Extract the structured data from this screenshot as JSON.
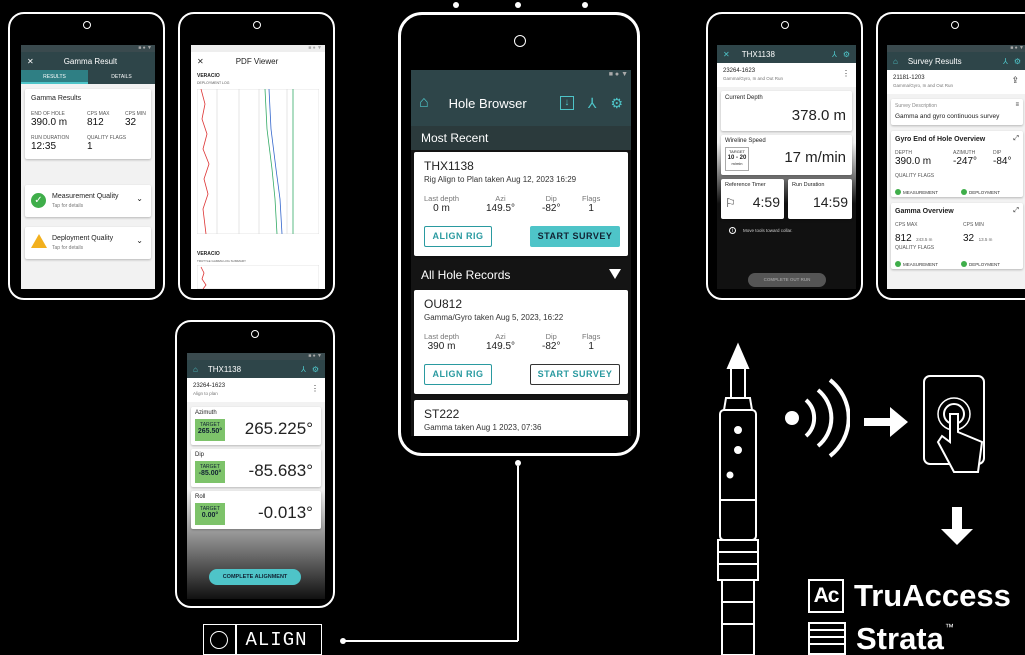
{
  "gamma": {
    "title": "Gamma Result",
    "tabs": [
      "RESULTS",
      "DETAILS"
    ],
    "heading": "Gamma Results",
    "stats": [
      {
        "k": "END OF HOLE",
        "v": "390.0 m"
      },
      {
        "k": "CPS MAX",
        "v": "812"
      },
      {
        "k": "CPS MIN",
        "v": "32"
      },
      {
        "k": "RUN DURATION",
        "v": "12:35"
      },
      {
        "k": "QUALITY FLAGS",
        "v": "1"
      }
    ],
    "measurement": {
      "title": "Measurement Quality",
      "sub": "Tap for details"
    },
    "deployment": {
      "title": "Deployment Quality",
      "sub": "Tap for details"
    }
  },
  "pdf": {
    "title": "PDF Viewer",
    "brand": "VERACIO",
    "sub1": "DEPLOYMENT LOG",
    "sub2": "TRUTYLE GAMMA LOG SUMMARY"
  },
  "browser": {
    "title": "Hole Browser",
    "recent": "Most Recent",
    "all": "All Hole Records",
    "labels": {
      "depth": "Last depth",
      "azi": "Azi",
      "dip": "Dip",
      "flags": "Flags"
    },
    "align": "ALIGN RIG",
    "start": "START SURVEY",
    "records": [
      {
        "id": "THX1138",
        "desc": "Rig Align to Plan taken Aug 12, 2023 16:29",
        "depth": "0 m",
        "azi": "149.5°",
        "dip": "-82°",
        "flags": "1"
      },
      {
        "id": "OU812",
        "desc": "Gamma/Gyro taken Aug 5, 2023, 16:22",
        "depth": "390 m",
        "azi": "149.5°",
        "dip": "-82°",
        "flags": "1"
      },
      {
        "id": "ST222",
        "desc": "Gamma taken Aug 1 2023, 07:36"
      }
    ]
  },
  "alignScreen": {
    "title": "THX1138",
    "hole": "23264-1623",
    "sub": "Align to plan",
    "rows": [
      {
        "k": "Azimuth",
        "t": "265.50°",
        "v": "265.225°"
      },
      {
        "k": "Dip",
        "t": "-85.00°",
        "v": "-85.683°"
      },
      {
        "k": "Roll",
        "t": "0.00°",
        "v": "-0.013°"
      }
    ],
    "target": "TARGET",
    "button": "COMPLETE ALIGNMENT"
  },
  "runScreen": {
    "title": "THX1138",
    "hole": "23264-1623",
    "sub": "Gamma/Gyro, In and Out Run",
    "depthLabel": "Current Depth",
    "depth": "378.0 m",
    "speedLabel": "Wireline Speed",
    "target": "TARGET",
    "targetVal": "10 - 20",
    "targetUnit": "m/min",
    "speed": "17 m/min",
    "timerLabel": "Reference Timer",
    "timer": "4:59",
    "durLabel": "Run Duration",
    "dur": "14:59",
    "info": "Move tools toward collar.",
    "button": "COMPLETE OUT RUN"
  },
  "survey": {
    "title": "Survey Results",
    "hole": "21181-1203",
    "sub": "Gamma/Gyro, In and Out Run",
    "descLabel": "Survey Description",
    "desc": "Gamma and gyro continuous survey",
    "gyro": {
      "title": "Gyro End of Hole Overview",
      "stats": [
        {
          "k": "DEPTH",
          "v": "390.0 m"
        },
        {
          "k": "AZIMUTH",
          "v": "-247°"
        },
        {
          "k": "DIP",
          "v": "-84°"
        }
      ]
    },
    "gammaOv": {
      "title": "Gamma Overview",
      "stats": [
        {
          "k": "CPS MAX",
          "v": "812",
          "u": "243.5 m"
        },
        {
          "k": "CPS MIN",
          "v": "32",
          "u": "13.5 m"
        }
      ]
    },
    "qf": "QUALITY FLAGS",
    "meas": "MEASUREMENT",
    "dep": "DEPLOYMENT"
  },
  "brands": {
    "align": "ALIGN",
    "truaccess": "TruAccess",
    "strata": "Strata",
    "tm": "™",
    "ac": "Ac"
  },
  "colors": {
    "teal": "#2e4549",
    "accent": "#4ec4c8",
    "green": "#3fae4a",
    "warn": "#f2b01e"
  }
}
